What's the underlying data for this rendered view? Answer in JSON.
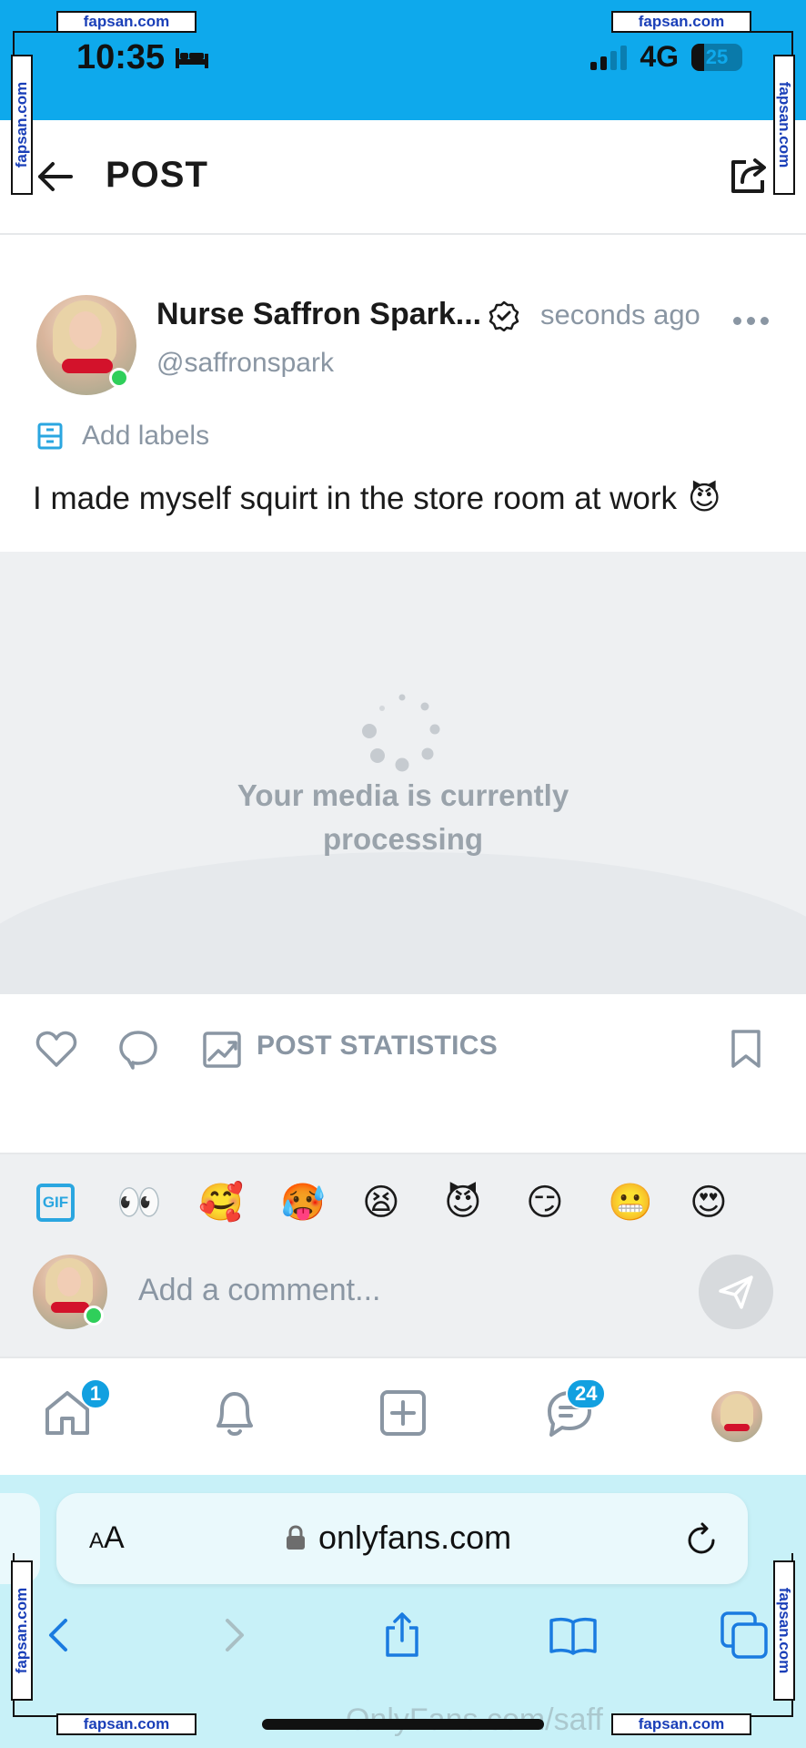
{
  "status_bar": {
    "time": "10:35",
    "network": "4G",
    "battery": "25",
    "battery_level": 0.25
  },
  "header": {
    "title": "POST"
  },
  "post": {
    "author_name": "Nurse Saffron Spark...",
    "time_ago": "seconds ago",
    "handle": "@saffronspark",
    "add_labels": "Add labels",
    "text": "I made myself squirt in the store room at work",
    "text_emoji": "😈",
    "media_message_line1": "Your media is currently",
    "media_message_line2": "processing",
    "stats_label": "POST STATISTICS"
  },
  "comment": {
    "gif_label": "GIF",
    "emojis": [
      "👀",
      "🥰",
      "🥵",
      "😫",
      "😈",
      "😏",
      "😬",
      "😍"
    ],
    "placeholder": "Add a comment..."
  },
  "bottom_nav": {
    "home_badge": "1",
    "messages_badge": "24"
  },
  "safari": {
    "aa_small": "A",
    "aa_large": "A",
    "url": "onlyfans.com",
    "bottom_url": "OnlyFans.com/saff"
  },
  "watermark": {
    "text": "fapsan.com"
  },
  "colors": {
    "status_bar": "#0ea9ec",
    "accent": "#12a0e0",
    "muted_text": "#8a96a3",
    "online": "#2fcf5a"
  },
  "icons": [
    "back-arrow-icon",
    "share-icon",
    "verified-icon",
    "more-icon",
    "labels-icon",
    "like-icon",
    "comment-icon",
    "stats-icon",
    "bookmark-icon",
    "send-icon",
    "home-icon",
    "bell-icon",
    "add-post-icon",
    "messages-icon",
    "lock-icon",
    "reload-icon",
    "safari-back-icon",
    "safari-forward-icon",
    "safari-share-icon",
    "bookmarks-icon",
    "tabs-icon",
    "bed-icon"
  ]
}
